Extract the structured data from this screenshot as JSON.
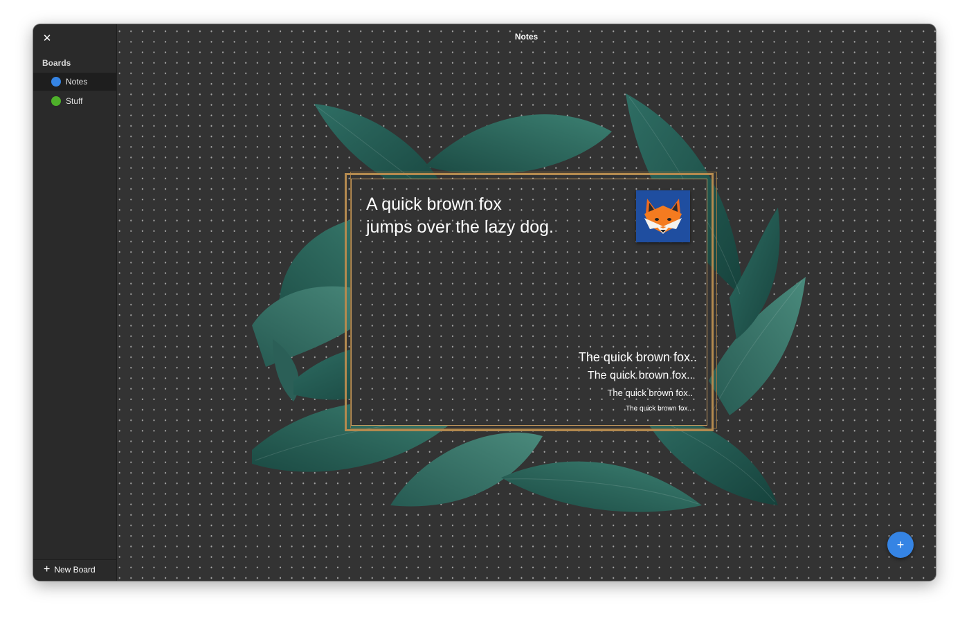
{
  "window": {
    "title": "Notes"
  },
  "sidebar": {
    "heading": "Boards",
    "items": [
      {
        "label": "Notes",
        "color": "#3584e4",
        "active": true
      },
      {
        "label": "Stuff",
        "color": "#4eb02a",
        "active": false
      }
    ],
    "new_board_label": "New Board"
  },
  "card": {
    "headline_line1": "A quick brown fox",
    "headline_line2": "jumps over the lazy dog.",
    "samples": [
      "The quick brown fox..",
      "The quick brown fox..",
      "The quick brown fox..",
      "The quick brown fox.."
    ]
  },
  "icons": {
    "close": "close-icon",
    "add": "plus-icon",
    "fox": "fox-icon"
  },
  "colors": {
    "accent": "#3584e4",
    "canvas_bg": "#333333",
    "sidebar_bg": "#2a2a2a",
    "frame_gold": "#b48a4f"
  }
}
